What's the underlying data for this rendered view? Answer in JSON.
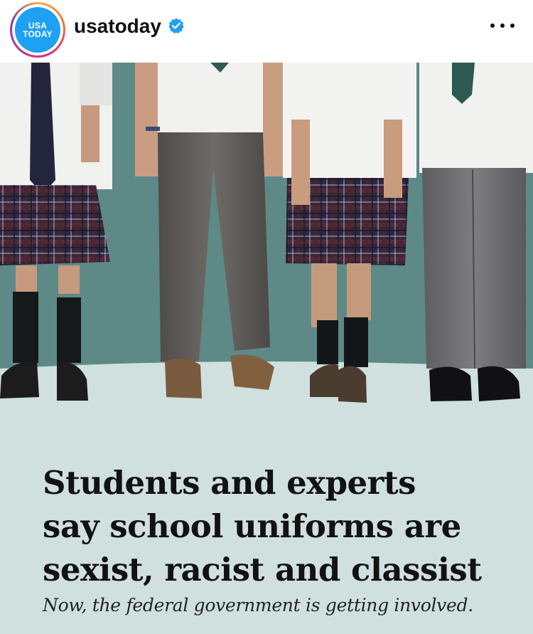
{
  "account": {
    "avatar_line1": "USA",
    "avatar_line2": "TODAY",
    "username": "usatoday",
    "verified_icon": "verified-badge-icon",
    "more_icon": "more-options-icon",
    "brand_color": "#1ea1f2",
    "verified_color": "#1da1f2"
  },
  "post": {
    "background_color": "#cfe0df",
    "photo_backdrop_color": "#5d8a86",
    "headline_lines": [
      "Students and experts",
      "say school uniforms are",
      "sexist, racist and classist"
    ],
    "subhead": "Now, the federal government is getting involved."
  }
}
